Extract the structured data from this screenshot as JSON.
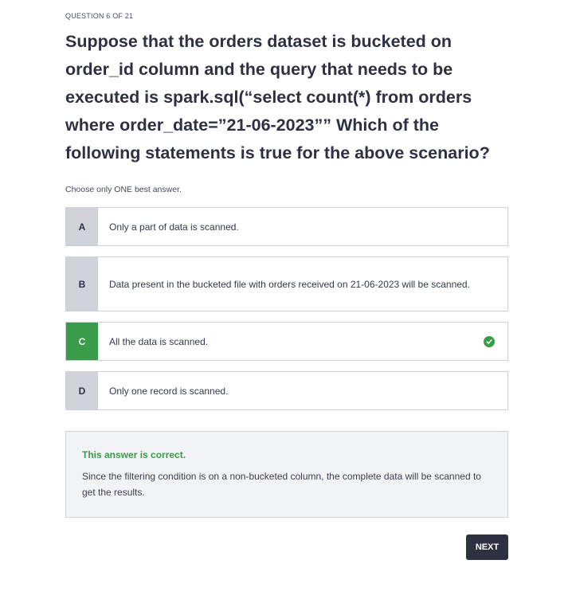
{
  "question": {
    "counter": "QUESTION 6 OF 21",
    "text": "Suppose that the orders dataset is bucketed on order_id column and the query that needs to be executed is spark.sql(“select count(*) from orders where order_date=”21-06-2023”” Which of the following statements is true for the above scenario?",
    "hint": "Choose only ONE best answer."
  },
  "options": [
    {
      "letter": "A",
      "text": "Only a part of data is scanned."
    },
    {
      "letter": "B",
      "text": "Data present in the bucketed file with orders received on 21-06-2023 will be scanned."
    },
    {
      "letter": "C",
      "text": "All the data is scanned.",
      "selected": true,
      "correct": true
    },
    {
      "letter": "D",
      "text": "Only one record is scanned."
    }
  ],
  "feedback": {
    "title": "This answer is correct.",
    "text": "Since the filtering condition is on a non-bucketed column, the complete data will be scanned to get the results."
  },
  "next_label": "NEXT",
  "colors": {
    "correct": "#3a9b48",
    "primary_button": "#2d3142",
    "letter_bg": "#d1d3db"
  },
  "icons": {
    "correct_indicator": "check-circle-icon"
  }
}
